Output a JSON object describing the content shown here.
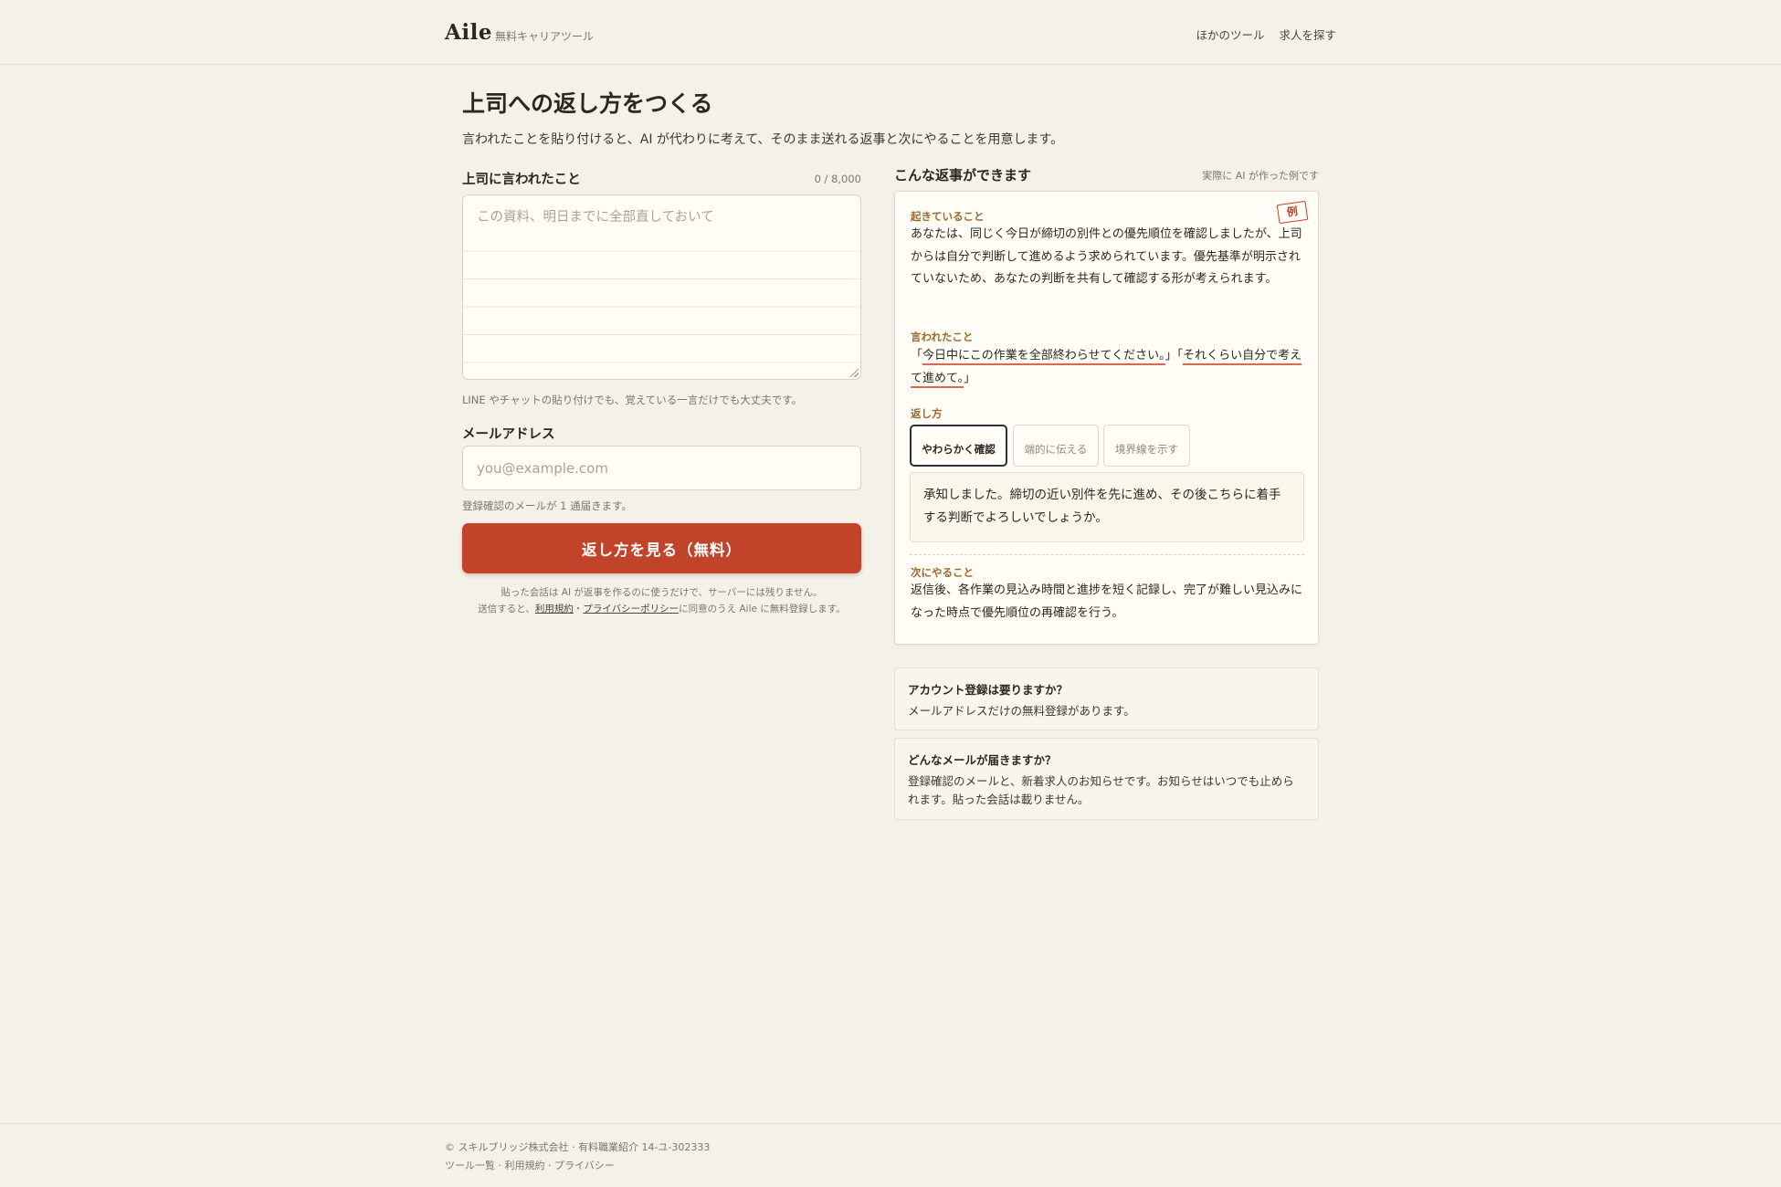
{
  "header": {
    "logo": "Aile",
    "logo_sub": "無料キャリアツール",
    "nav": [
      "ほかのツール",
      "求人を探す"
    ]
  },
  "page": {
    "title": "上司への返し方をつくる",
    "description": "言われたことを貼り付けると、AI が代わりに考えて、そのまま送れる返事と次にやることを用意します。"
  },
  "form": {
    "message_label": "上司に言われたこと",
    "message_counter": "0 / 8,000",
    "message_placeholder": "この資料、明日までに全部直しておいて",
    "message_hint": "LINE やチャットの貼り付けでも、覚えている一言だけでも大丈夫です。",
    "email_label": "メールアドレス",
    "email_placeholder": "you@example.com",
    "email_hint": "登録確認のメールが 1 通届きます。",
    "submit_label": "返し方を見る（無料）",
    "privacy_note": "貼った会話は AI が返事を作るのに使うだけで、サーバーには残りません。",
    "consent_prefix": "送信すると、",
    "terms_link": "利用規約",
    "consent_sep": "・",
    "privacy_link": "プライバシーポリシー",
    "consent_suffix": "に同意のうえ Aile に無料登録します。"
  },
  "example": {
    "title": "こんな返事ができます",
    "note": "実際に AI が作った例です",
    "stamp": "例",
    "situation_label": "起きていること",
    "situation_text": "あなたは、同じく今日が締切の別件との優先順位を確認しましたが、上司からは自分で判断して進めるよう求められています。優先基準が明示されていないため、あなたの判断を共有して確認する形が考えられます。",
    "said_label": "言われたこと",
    "said_open": "「",
    "said_quote_1": "今日中にこの作業を全部終わらせてください。",
    "said_mid": "」「",
    "said_quote_2": "それくらい自分で考えて進めて。",
    "said_close": "」",
    "reply_label": "返し方",
    "tones": [
      "やわらかく確認",
      "端的に伝える",
      "境界線を示す"
    ],
    "reply_text": "承知しました。締切の近い別件を先に進め、その後こちらに着手する判断でよろしいでしょうか。",
    "next_label": "次にやること",
    "next_text": "返信後、各作業の見込み時間と進捗を短く記録し、完了が難しい見込みになった時点で優先順位の再確認を行う。"
  },
  "faq": [
    {
      "q": "アカウント登録は要りますか？",
      "a": "メールアドレスだけの無料登録があります。"
    },
    {
      "q": "どんなメールが届きますか？",
      "a": "登録確認のメールと、新着求人のお知らせです。お知らせはいつでも止められます。貼った会話は載りません。"
    }
  ],
  "footer": {
    "copyright": "© スキルブリッジ株式会社 · 有料職業紹介 14-ユ-302333",
    "links": [
      "ツール一覧",
      "利用規約",
      "プライバシー"
    ],
    "link_sep": " · "
  }
}
